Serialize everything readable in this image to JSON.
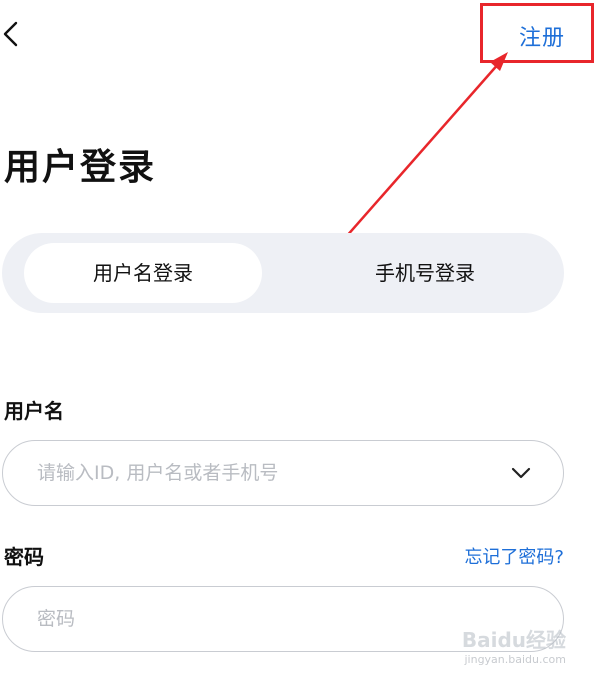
{
  "header": {
    "back_icon": "chevron-left-icon",
    "register_label": "注册"
  },
  "title": "用户登录",
  "tabs": [
    {
      "label": "用户名登录",
      "active": true
    },
    {
      "label": "手机号登录",
      "active": false
    }
  ],
  "username": {
    "label": "用户名",
    "placeholder": "请输入ID, 用户名或者手机号",
    "value": "",
    "dropdown_icon": "chevron-down-icon"
  },
  "password": {
    "label": "密码",
    "forgot_label": "忘记了密码?",
    "placeholder": "密码",
    "value": ""
  },
  "colors": {
    "link": "#1e6fd8",
    "annotation": "#e8262b",
    "tab_bar": "#eef0f5"
  },
  "watermark": {
    "brand": "Baidu经验",
    "url": "jingyan.baidu.com"
  }
}
